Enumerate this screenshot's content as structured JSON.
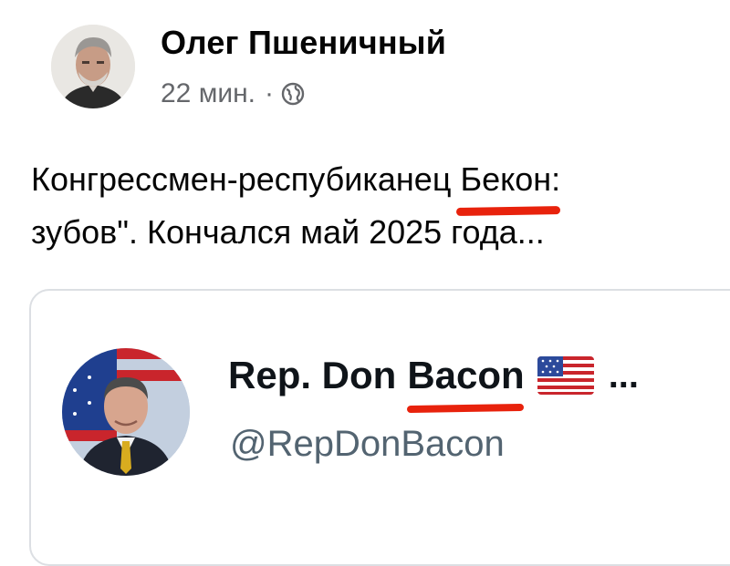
{
  "post": {
    "author_name": "Олег Пшеничный",
    "timestamp": "22 мин.",
    "separator": "·",
    "privacy_icon": "globe-icon",
    "text_line1_before": "Конгрессмен-респубиканец ",
    "text_line1_highlight": "Бекон",
    "text_line1_after": ": ",
    "text_line2": "зубов\". Кончался май 2025 года..."
  },
  "embed": {
    "name_prefix": "Rep. Don",
    "name_highlight": "Bacon",
    "flag_icon": "us-flag-icon",
    "more": "...",
    "handle": "@RepDonBacon"
  },
  "colors": {
    "underline": "#e8220c",
    "secondary_text": "#65676b",
    "card_border": "#dcdfe3"
  }
}
